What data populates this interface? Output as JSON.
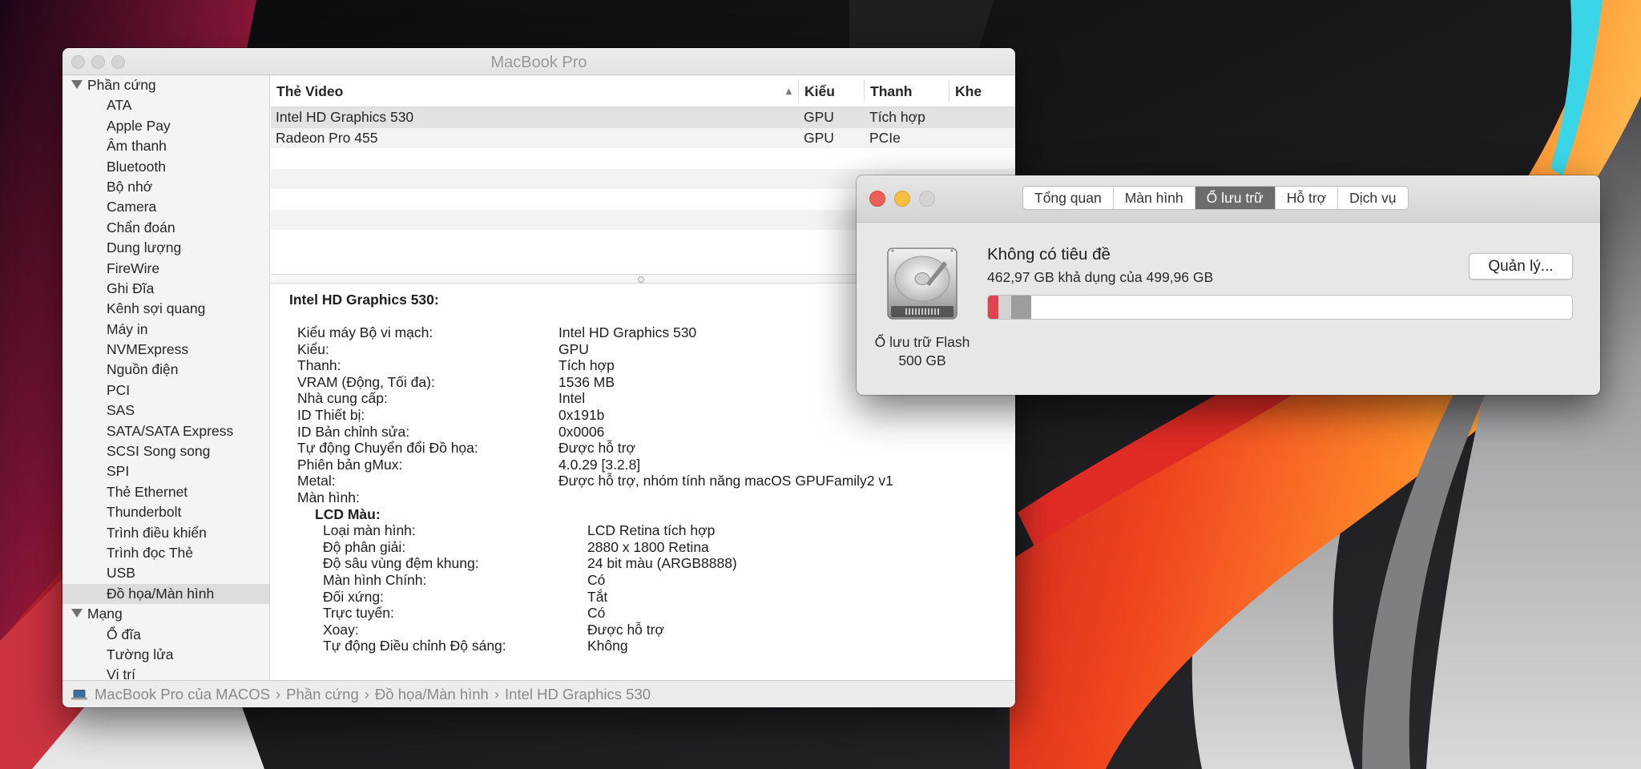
{
  "system_info": {
    "window_title": "MacBook Pro",
    "sidebar": {
      "groups": [
        {
          "label": "Phần cứng",
          "items": [
            "ATA",
            "Apple Pay",
            "Âm thanh",
            "Bluetooth",
            "Bộ nhớ",
            "Camera",
            "Chẩn đoán",
            "Dung lượng",
            "FireWire",
            "Ghi Đĩa",
            "Kênh sợi quang",
            "Máy in",
            "NVMExpress",
            "Nguồn điện",
            "PCI",
            "SAS",
            "SATA/SATA Express",
            "SCSI Song song",
            "SPI",
            "Thẻ Ethernet",
            "Thunderbolt",
            "Trình điều khiển",
            "Trình đọc Thẻ",
            "USB",
            "Đồ họa/Màn hình"
          ]
        },
        {
          "label": "Mạng",
          "items": [
            "Ổ đĩa",
            "Tường lửa",
            "Vị trí"
          ]
        }
      ],
      "selected_item": "Đồ họa/Màn hình"
    },
    "table": {
      "columns": [
        "Thẻ Video",
        "Kiểu",
        "Thanh",
        "Khe"
      ],
      "rows": [
        [
          "Intel HD Graphics 530",
          "GPU",
          "Tích hợp",
          ""
        ],
        [
          "Radeon Pro 455",
          "GPU",
          "PCIe",
          ""
        ]
      ]
    },
    "details": {
      "heading": "Intel HD Graphics 530:",
      "fields": [
        [
          "Kiểu máy Bộ vi mạch:",
          "Intel HD Graphics 530"
        ],
        [
          "Kiểu:",
          "GPU"
        ],
        [
          "Thanh:",
          "Tích hợp"
        ],
        [
          "VRAM (Động, Tối đa):",
          "1536 MB"
        ],
        [
          "Nhà cung cấp:",
          "Intel"
        ],
        [
          "ID Thiết bị:",
          "0x191b"
        ],
        [
          "ID Bản chỉnh sửa:",
          "0x0006"
        ],
        [
          "Tự động Chuyển đổi Đồ họa:",
          "Được hỗ trợ"
        ],
        [
          "Phiên bản gMux:",
          "4.0.29 [3.2.8]"
        ],
        [
          "Metal:",
          "Được hỗ trợ, nhóm tính năng macOS GPUFamily2 v1"
        ]
      ],
      "displays_label": "Màn hình:",
      "display_name": "LCD Màu:",
      "display_fields": [
        [
          "Loại màn hình:",
          "LCD Retina tích hợp"
        ],
        [
          "Độ phân giải:",
          "2880 x 1800 Retina"
        ],
        [
          "Độ sâu vùng đệm khung:",
          "24 bit màu (ARGB8888)"
        ],
        [
          "Màn hình Chính:",
          "Có"
        ],
        [
          "Đối xứng:",
          "Tắt"
        ],
        [
          "Trực tuyến:",
          "Có"
        ],
        [
          "Xoay:",
          "Được hỗ trợ"
        ],
        [
          "Tự động Điều chỉnh Độ sáng:",
          "Không"
        ]
      ]
    },
    "breadcrumb": [
      "MacBook Pro của MACOS",
      "Phần cứng",
      "Đồ họa/Màn hình",
      "Intel HD Graphics 530"
    ],
    "breadcrumb_separator": "›"
  },
  "about": {
    "tabs": [
      "Tổng quan",
      "Màn hình",
      "Ổ lưu trữ",
      "Hỗ trợ",
      "Dịch vụ"
    ],
    "active_tab": "Ổ lưu trữ",
    "disk_label": "Ổ lưu trữ Flash",
    "disk_size": "500 GB",
    "volume_name": "Không có tiêu đề",
    "available_text": "462,97 GB khả dụng của 499,96 GB",
    "manage_button": "Quản lý...",
    "usage_fraction": 0.074,
    "colors": {
      "close": "#ec5f57",
      "minimize": "#f5be3f",
      "usage_red": "#e0434f",
      "usage_light": "#d2d2d2",
      "usage_gray": "#9d9d9d"
    }
  },
  "icons": {
    "sort_ascending": "sort-ascending-icon",
    "disclosure": "disclosure-triangle-icon",
    "laptop": "laptop-icon",
    "hard_drive": "hard-drive-icon"
  }
}
